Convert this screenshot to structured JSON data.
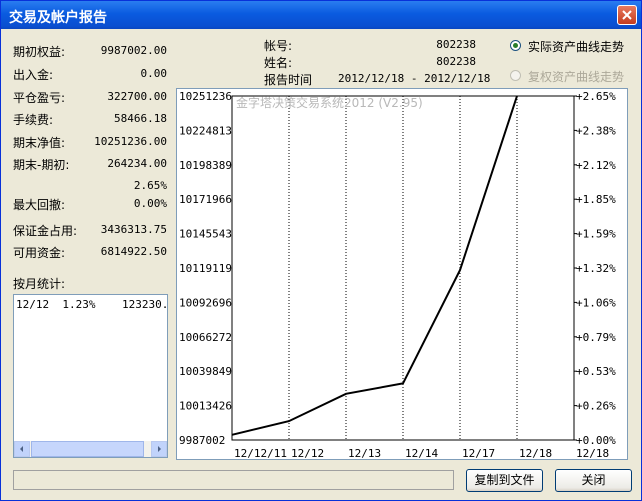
{
  "window": {
    "title": "交易及帐户报告"
  },
  "summary": [
    {
      "label": "期初权益:",
      "value": "9987002.00"
    },
    {
      "label": "出入金:",
      "value": "0.00"
    },
    {
      "label": "平仓盈亏:",
      "value": "322700.00"
    },
    {
      "label": "手续费:",
      "value": "58466.18"
    },
    {
      "label": "期末净值:",
      "value": "10251236.00"
    },
    {
      "label": "期末-期初:",
      "value": "264234.00"
    },
    {
      "label": "",
      "value": "2.65%"
    },
    {
      "label": "最大回撤:",
      "value": "0.00%"
    },
    {
      "label": "保证金占用:",
      "value": "3436313.75"
    },
    {
      "label": "可用资金:",
      "value": "6814922.50"
    }
  ],
  "account": {
    "account_label": "帐号:",
    "account_value": "802238",
    "name_label": "姓名:",
    "name_value": "802238",
    "period_label": "报告时间",
    "period_value": "2012/12/18 - 2012/12/18"
  },
  "options": {
    "actual": "实际资产曲线走势",
    "adjusted": "复权资产曲线走势"
  },
  "monthly": {
    "label": "按月统计:",
    "rows": [
      {
        "text": "12/12  1.23%    123230."
      }
    ]
  },
  "buttons": {
    "copy": "复制到文件",
    "close": "关闭"
  },
  "status": {
    "text": ""
  },
  "chart_data": {
    "type": "line",
    "watermark": "金字塔决策交易系统2012 (V2.95)",
    "x": [
      "12/12/11",
      "12/12",
      "12/13",
      "12/14",
      "12/17",
      "12/18"
    ],
    "series": [
      {
        "values": [
          9991000,
          10001500,
          10022500,
          10030500,
          10117500,
          10251236
        ]
      }
    ],
    "ylim": [
      9987002,
      10251236
    ],
    "y_ticks_left": [
      "10251236",
      "10224813",
      "10198389",
      "10171966",
      "10145543",
      "10119119",
      "10092696",
      "10066272",
      "10039849",
      "10013426",
      "9987002"
    ],
    "y_ticks_right": [
      "+2.65%",
      "+2.38%",
      "+2.12%",
      "+1.85%",
      "+1.59%",
      "+1.32%",
      "+1.06%",
      "+0.79%",
      "+0.53%",
      "+0.26%",
      "+0.00%"
    ],
    "x_ticks": [
      "12/12/11",
      "12/12",
      "12/13",
      "12/14",
      "12/17",
      "12/18",
      "12/18"
    ],
    "grid": true
  },
  "colors": {
    "titlebar": "#0a5be0",
    "line": "#000000",
    "grid": "#000000"
  }
}
